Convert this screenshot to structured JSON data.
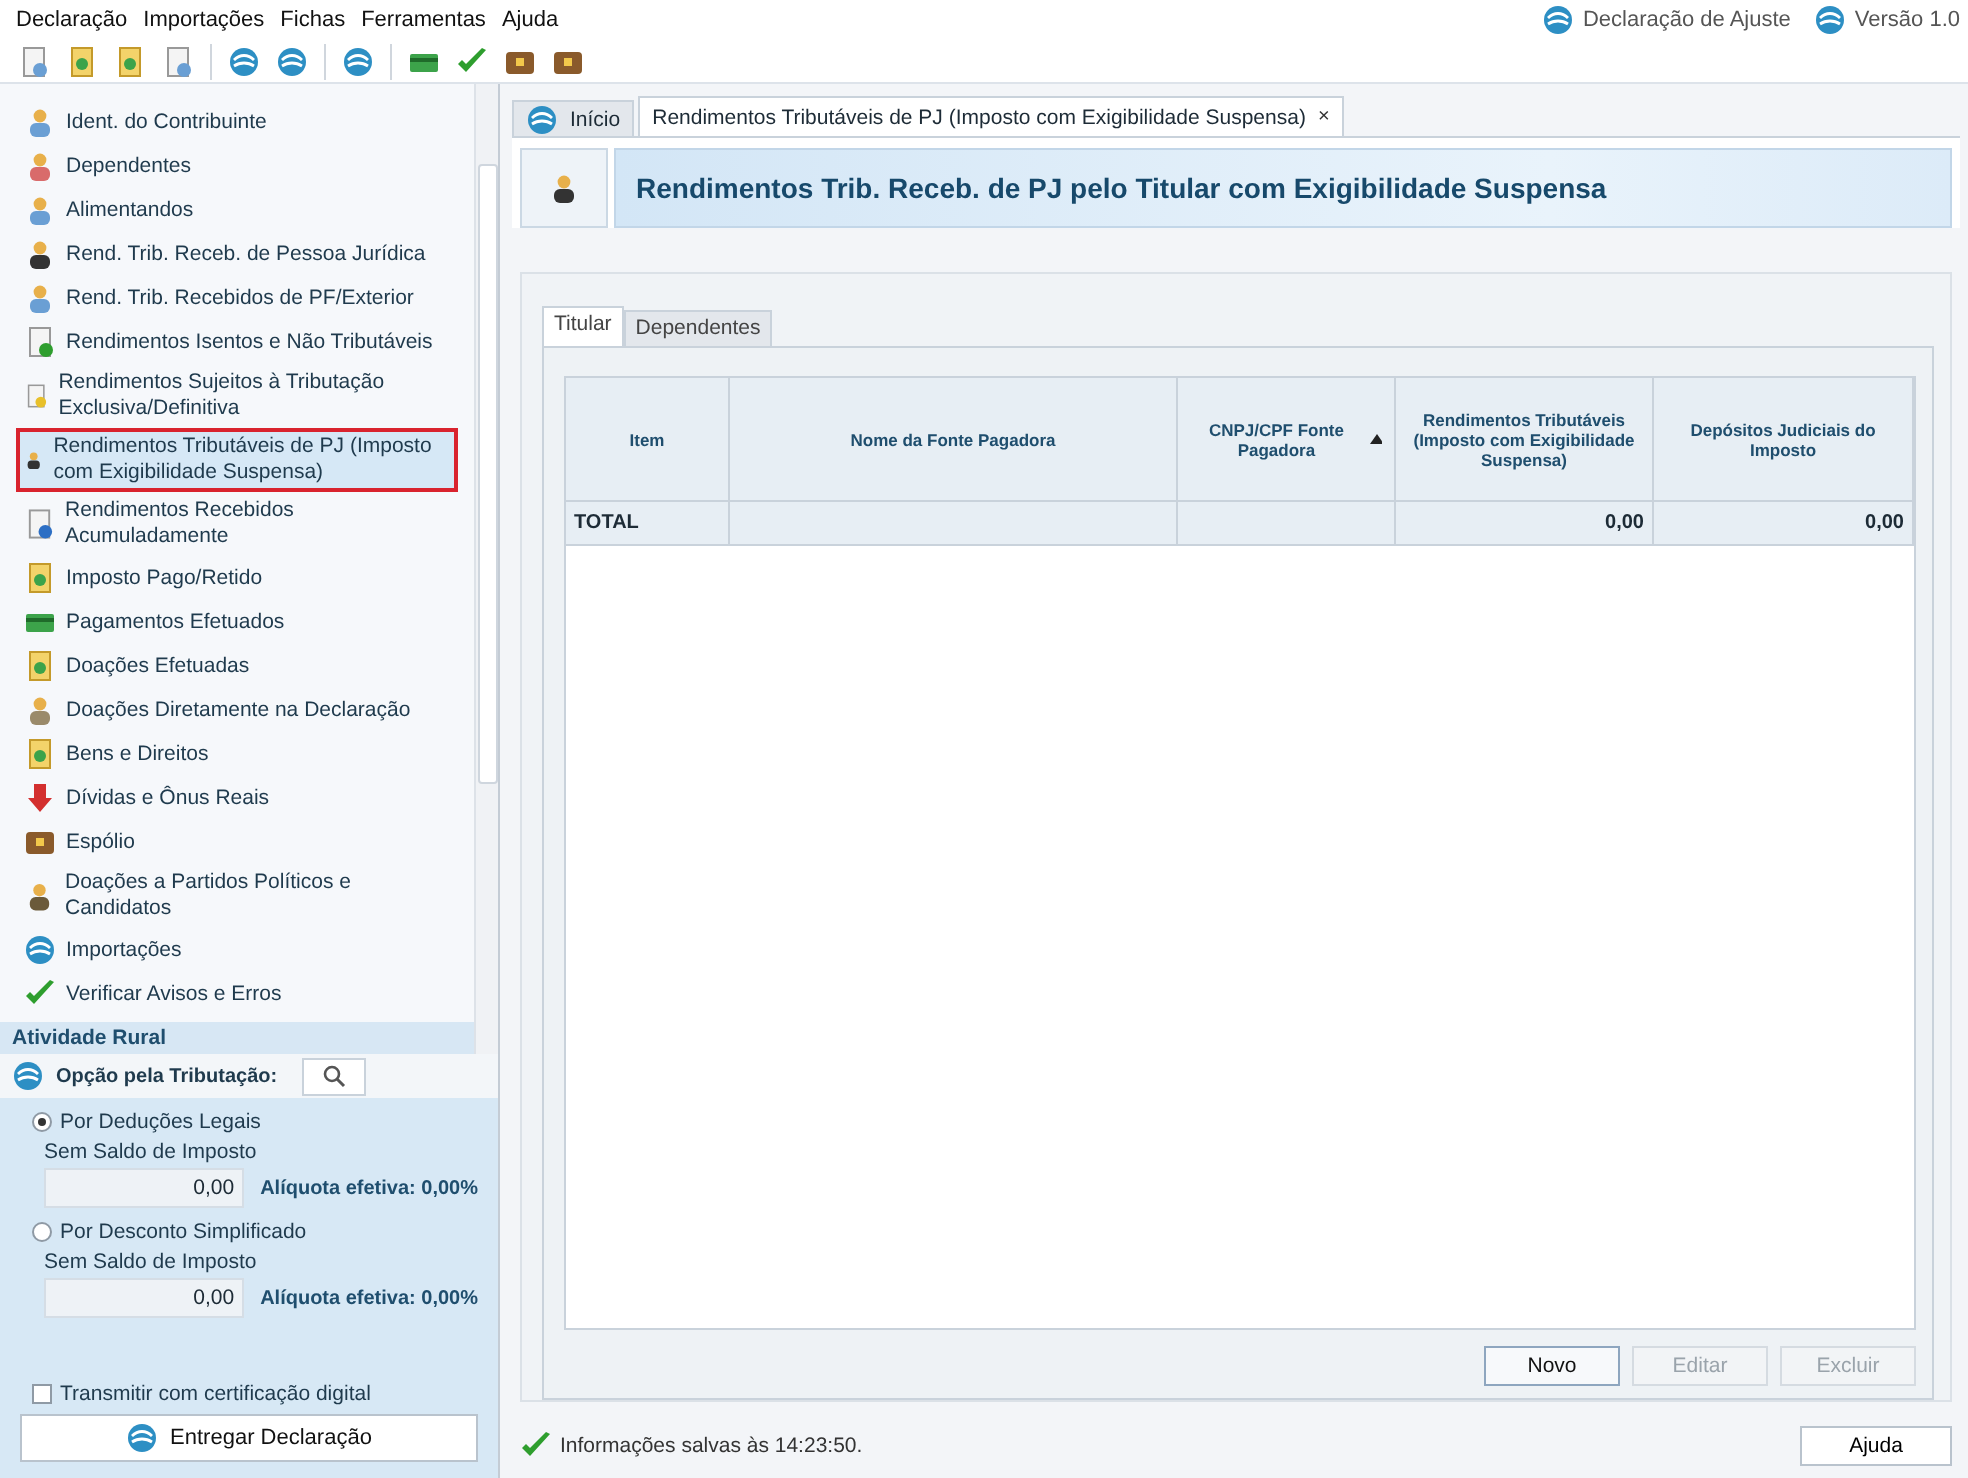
{
  "menu": [
    "Declaração",
    "Importações",
    "Fichas",
    "Ferramentas",
    "Ajuda"
  ],
  "top_right": [
    "Declaração de Ajuste",
    "Versão 1.0"
  ],
  "sidebar": {
    "items": [
      {
        "label": "Ident. do Contribuinte",
        "selected": false
      },
      {
        "label": "Dependentes",
        "selected": false
      },
      {
        "label": "Alimentandos",
        "selected": false
      },
      {
        "label": "Rend. Trib. Receb. de Pessoa Jurídica",
        "selected": false
      },
      {
        "label": "Rend. Trib. Recebidos de PF/Exterior",
        "selected": false
      },
      {
        "label": "Rendimentos Isentos e Não Tributáveis",
        "selected": false
      },
      {
        "label": "Rendimentos Sujeitos à Tributação Exclusiva/Definitiva",
        "selected": false
      },
      {
        "label": "Rendimentos Tributáveis de PJ (Imposto com Exigibilidade Suspensa)",
        "selected": true
      },
      {
        "label": "Rendimentos Recebidos Acumuladamente",
        "selected": false
      },
      {
        "label": "Imposto Pago/Retido",
        "selected": false
      },
      {
        "label": "Pagamentos Efetuados",
        "selected": false
      },
      {
        "label": "Doações Efetuadas",
        "selected": false
      },
      {
        "label": "Doações Diretamente na Declaração",
        "selected": false
      },
      {
        "label": "Bens e Direitos",
        "selected": false
      },
      {
        "label": "Dívidas e Ônus Reais",
        "selected": false
      },
      {
        "label": "Espólio",
        "selected": false
      },
      {
        "label": "Doações a Partidos Políticos e Candidatos",
        "selected": false
      },
      {
        "label": "Importações",
        "selected": false
      },
      {
        "label": "Verificar Avisos e Erros",
        "selected": false
      }
    ],
    "section": "Atividade Rural"
  },
  "tax_option": {
    "label": "Opção pela Tributação:",
    "options": [
      {
        "label": "Por Deduções Legais",
        "selected": true,
        "sublabel": "Sem Saldo de Imposto",
        "value": "0,00",
        "rate": "Alíquota efetiva: 0,00%"
      },
      {
        "label": "Por Desconto Simplificado",
        "selected": false,
        "sublabel": "Sem Saldo de Imposto",
        "value": "0,00",
        "rate": "Alíquota efetiva: 0,00%"
      }
    ],
    "certificate": {
      "label": "Transmitir com certificação digital",
      "checked": false
    },
    "submit": "Entregar Declaração"
  },
  "doc_tabs": [
    {
      "label": "Início",
      "selected": false,
      "closable": false
    },
    {
      "label": "Rendimentos Tributáveis de PJ (Imposto com Exigibilidade Suspensa)",
      "selected": true,
      "closable": true
    }
  ],
  "close_glyph": "×",
  "page_title": "Rendimentos Trib. Receb. de PJ pelo Titular com Exigibilidade Suspensa",
  "sub_tabs": [
    {
      "label": "Titular",
      "selected": true
    },
    {
      "label": "Dependentes",
      "selected": false
    }
  ],
  "table": {
    "columns": [
      {
        "label": "Item",
        "sorted": false
      },
      {
        "label": "Nome da Fonte Pagadora",
        "sorted": false
      },
      {
        "label": "CNPJ/CPF Fonte Pagadora",
        "sorted": true
      },
      {
        "label": "Rendimentos Tributáveis (Imposto com Exigibilidade Suspensa)",
        "sorted": false
      },
      {
        "label": "Depósitos Judiciais do Imposto",
        "sorted": false
      }
    ],
    "total_row": {
      "label": "TOTAL",
      "rendimentos": "0,00",
      "depositos": "0,00"
    }
  },
  "buttons": [
    {
      "label": "Novo",
      "disabled": false
    },
    {
      "label": "Editar",
      "disabled": true
    },
    {
      "label": "Excluir",
      "disabled": true
    }
  ],
  "status": "Informações salvas às 14:23:50.",
  "help_button": "Ajuda"
}
